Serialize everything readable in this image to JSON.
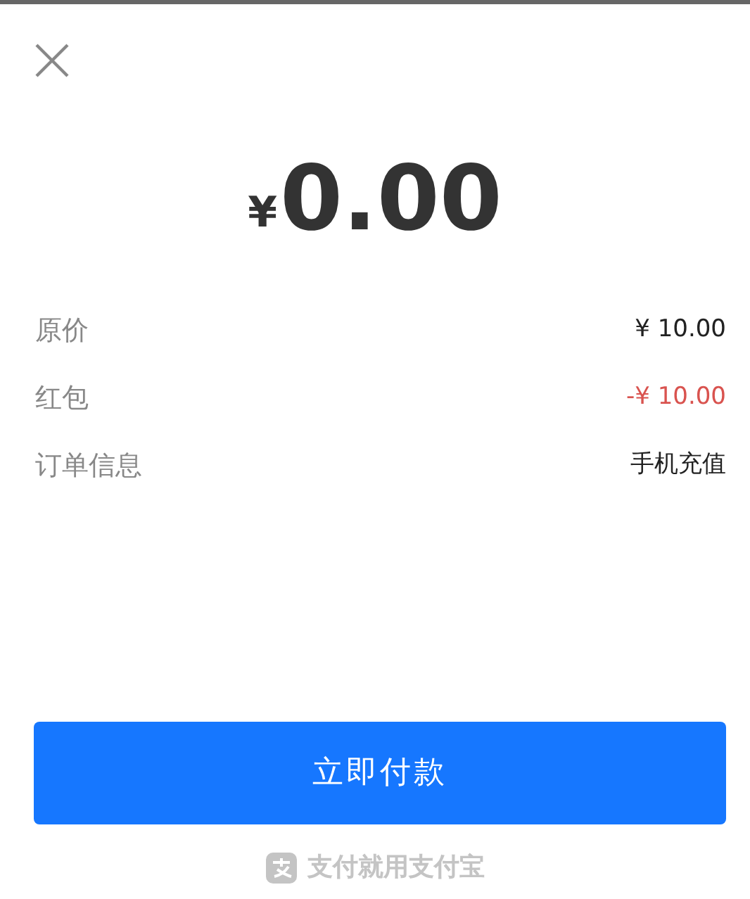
{
  "amount": {
    "currency": "¥",
    "value": "0.00"
  },
  "rows": [
    {
      "label": "原价",
      "value": "¥ 10.00",
      "kind": "plain"
    },
    {
      "label": "红包",
      "value": "-¥ 10.00",
      "kind": "discount"
    },
    {
      "label": "订单信息",
      "value": "手机充值",
      "kind": "plain"
    }
  ],
  "pay_button": "立即付款",
  "footer": "支付就用支付宝"
}
